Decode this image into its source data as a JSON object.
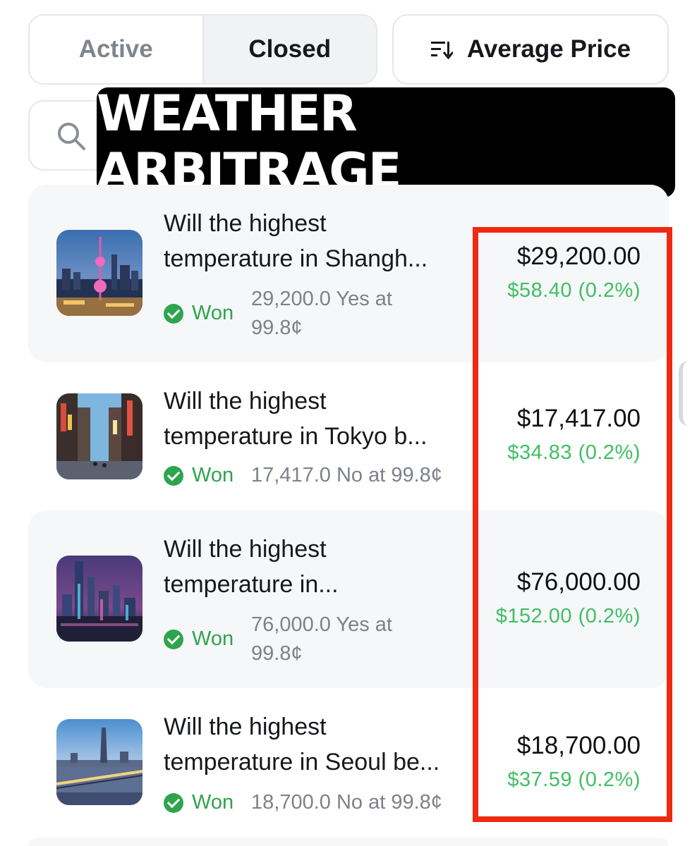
{
  "tabs": {
    "active_label": "Active",
    "closed_label": "Closed"
  },
  "sort": {
    "label": "Average Price",
    "icon": "sort-descending-icon"
  },
  "search": {
    "placeholder": "",
    "icon": "search-icon"
  },
  "banner": {
    "text": "WEATHER ARBITRAGE"
  },
  "colors": {
    "won_green": "#2ea44f",
    "pnl_green": "#3fbf63",
    "highlight_red": "#ee2a12",
    "banner_bg": "#000000"
  },
  "positions": [
    {
      "title_line1": "Will the highest",
      "title_line2": "temperature in Shangh...",
      "status": "Won",
      "detail": "29,200.0 Yes at 99.8¢",
      "value": "$29,200.00",
      "pnl": "$58.40 (0.2%)",
      "image": "shanghai-skyline"
    },
    {
      "title_line1": "Will the highest",
      "title_line2": "temperature in Tokyo b...",
      "status": "Won",
      "detail": "17,417.0 No at 99.8¢",
      "value": "$17,417.00",
      "pnl": "$34.83 (0.2%)",
      "image": "tokyo-street"
    },
    {
      "title_line1": "Will the highest",
      "title_line2": "temperature in...",
      "status": "Won",
      "detail": "76,000.0 Yes at 99.8¢",
      "value": "$76,000.00",
      "pnl": "$152.00 (0.2%)",
      "image": "city-night-skyline"
    },
    {
      "title_line1": "Will the highest",
      "title_line2": "temperature in Seoul be...",
      "status": "Won",
      "detail": "18,700.0 No at 99.8¢",
      "value": "$18,700.00",
      "pnl": "$37.59 (0.2%)",
      "image": "seoul-bridge"
    }
  ]
}
